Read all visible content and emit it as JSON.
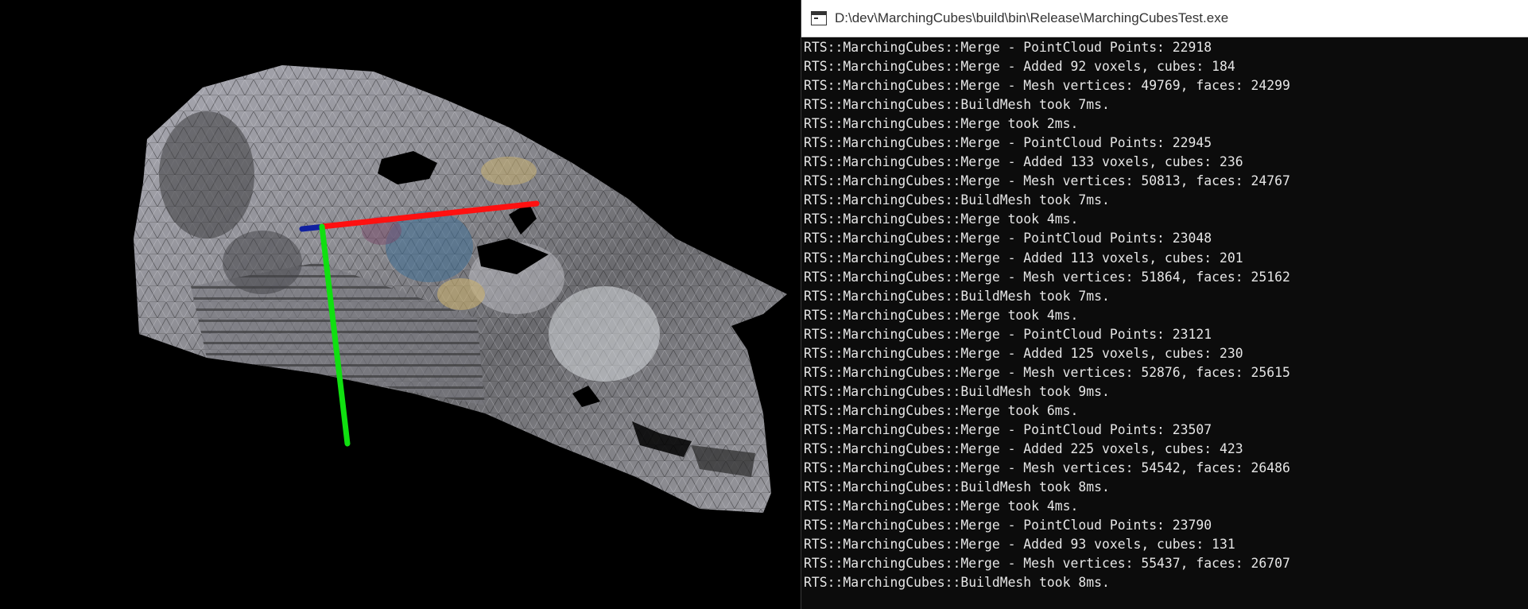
{
  "console": {
    "title": "D:\\dev\\MarchingCubes\\build\\bin\\Release\\MarchingCubesTest.exe",
    "lines": [
      "RTS::MarchingCubes::Merge - PointCloud Points: 22918",
      "RTS::MarchingCubes::Merge - Added 92 voxels, cubes: 184",
      "RTS::MarchingCubes::Merge - Mesh vertices: 49769, faces: 24299",
      "RTS::MarchingCubes::BuildMesh took 7ms.",
      "RTS::MarchingCubes::Merge took 2ms.",
      "RTS::MarchingCubes::Merge - PointCloud Points: 22945",
      "RTS::MarchingCubes::Merge - Added 133 voxels, cubes: 236",
      "RTS::MarchingCubes::Merge - Mesh vertices: 50813, faces: 24767",
      "RTS::MarchingCubes::BuildMesh took 7ms.",
      "RTS::MarchingCubes::Merge took 4ms.",
      "RTS::MarchingCubes::Merge - PointCloud Points: 23048",
      "RTS::MarchingCubes::Merge - Added 113 voxels, cubes: 201",
      "RTS::MarchingCubes::Merge - Mesh vertices: 51864, faces: 25162",
      "RTS::MarchingCubes::BuildMesh took 7ms.",
      "RTS::MarchingCubes::Merge took 4ms.",
      "RTS::MarchingCubes::Merge - PointCloud Points: 23121",
      "RTS::MarchingCubes::Merge - Added 125 voxels, cubes: 230",
      "RTS::MarchingCubes::Merge - Mesh vertices: 52876, faces: 25615",
      "RTS::MarchingCubes::BuildMesh took 9ms.",
      "RTS::MarchingCubes::Merge took 6ms.",
      "RTS::MarchingCubes::Merge - PointCloud Points: 23507",
      "RTS::MarchingCubes::Merge - Added 225 voxels, cubes: 423",
      "RTS::MarchingCubes::Merge - Mesh vertices: 54542, faces: 26486",
      "RTS::MarchingCubes::BuildMesh took 8ms.",
      "RTS::MarchingCubes::Merge took 4ms.",
      "RTS::MarchingCubes::Merge - PointCloud Points: 23790",
      "RTS::MarchingCubes::Merge - Added 93 voxels, cubes: 131",
      "RTS::MarchingCubes::Merge - Mesh vertices: 55437, faces: 26707",
      "RTS::MarchingCubes::BuildMesh took 8ms."
    ]
  },
  "viewport": {
    "axis_colors": {
      "x": "#ff1010",
      "y": "#10e010",
      "z": "#1020a0"
    },
    "mesh_colors": [
      "#b8b8c4",
      "#8a8a90",
      "#5a5a5e",
      "#3a3a3c",
      "#d8d8de",
      "#c9b070",
      "#4a7fa8"
    ]
  }
}
